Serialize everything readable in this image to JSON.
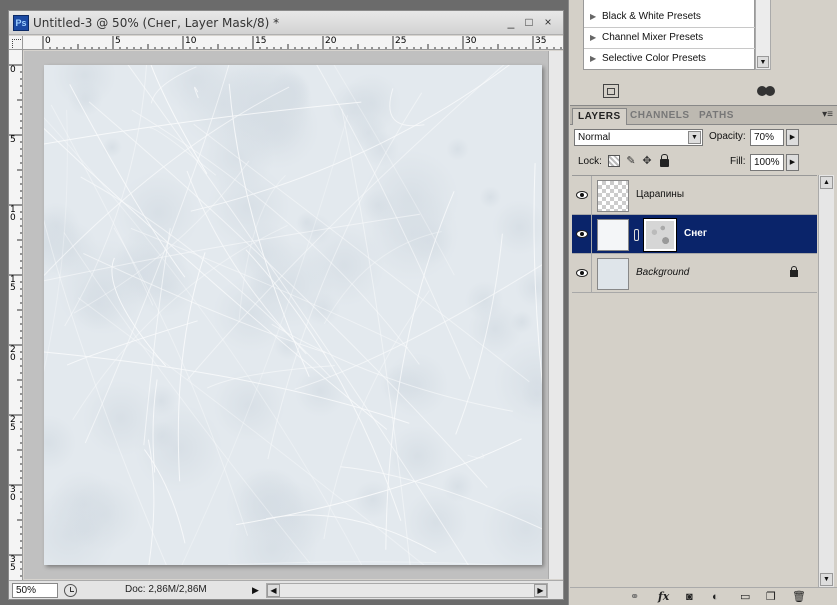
{
  "document": {
    "app_logo": "Ps",
    "title": "Untitled-3 @ 50% (Снег, Layer Mask/8) *",
    "controls": {
      "minimize": "_",
      "maximize": "□",
      "close": "×"
    },
    "ruler_top": [
      "0",
      "5",
      "10",
      "15",
      "20",
      "25",
      "30",
      "35"
    ],
    "ruler_left": [
      "0",
      "5",
      "1\n0",
      "1\n5",
      "2\n0",
      "2\n5",
      "3\n0",
      "3\n5"
    ],
    "status": {
      "zoom": "50%",
      "doc_info": "Doc: 2,86M/2,86M",
      "arrow": "▶"
    }
  },
  "adjustments": {
    "presets": [
      {
        "label": "Black & White Presets"
      },
      {
        "label": "Channel Mixer Presets"
      },
      {
        "label": "Selective Color Presets"
      }
    ]
  },
  "layers_panel": {
    "tabs": [
      {
        "label": "LAYERS",
        "active": true
      },
      {
        "label": "CHANNELS",
        "active": false
      },
      {
        "label": "PATHS",
        "active": false
      }
    ],
    "menu_glyph": "▾≡",
    "blend_mode": "Normal",
    "opacity_label": "Opacity:",
    "opacity": "70%",
    "lock_label": "Lock:",
    "fill_label": "Fill:",
    "fill": "100%",
    "layers": [
      {
        "name": "Царапины",
        "selected": false,
        "italic": false,
        "has_mask": false,
        "locked": false
      },
      {
        "name": "Снег",
        "selected": true,
        "italic": false,
        "has_mask": true,
        "locked": false
      },
      {
        "name": "Background",
        "selected": false,
        "italic": true,
        "has_mask": false,
        "locked": true
      }
    ],
    "bottom_icons": [
      "link-layers-icon",
      "fx-icon",
      "add-mask-icon",
      "adjustment-layer-icon",
      "new-group-icon",
      "new-layer-icon",
      "trash-icon"
    ]
  },
  "colors": {
    "selection": "#0a246a",
    "canvas": "#e3e9ee",
    "panel": "#d4d0c8"
  }
}
